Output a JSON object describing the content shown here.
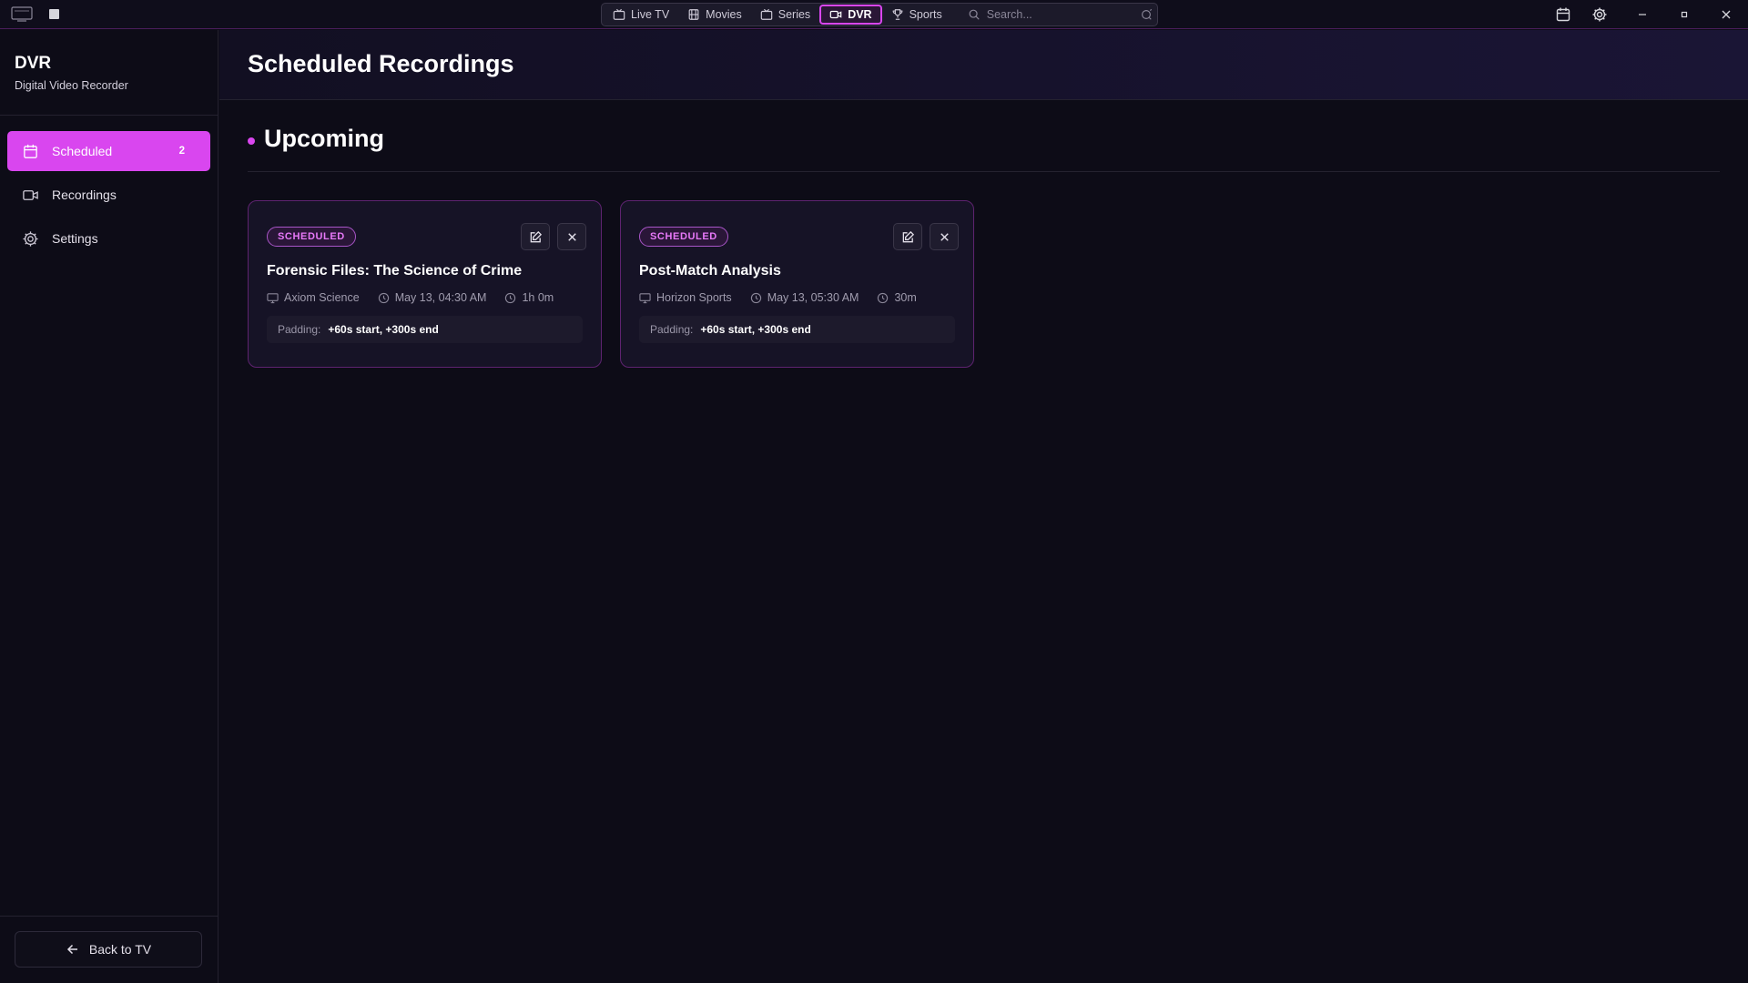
{
  "titlebar": {
    "nav_tabs": [
      {
        "label": "Live TV",
        "icon": "tv-icon"
      },
      {
        "label": "Movies",
        "icon": "film-icon"
      },
      {
        "label": "Series",
        "icon": "tv-icon"
      },
      {
        "label": "DVR",
        "icon": "video-icon",
        "active": true
      },
      {
        "label": "Sports",
        "icon": "trophy-icon"
      }
    ],
    "search_placeholder": "Search...",
    "accent": "#d946ef"
  },
  "sidebar": {
    "title": "DVR",
    "subtitle": "Digital Video Recorder",
    "items": [
      {
        "label": "Scheduled",
        "badge": "2",
        "icon": "calendar-icon",
        "active": true
      },
      {
        "label": "Recordings",
        "icon": "video-icon"
      },
      {
        "label": "Settings",
        "icon": "gear-icon"
      }
    ],
    "back_label": "Back to TV"
  },
  "main": {
    "title": "Scheduled Recordings",
    "section_title": "Upcoming",
    "cards": [
      {
        "status": "SCHEDULED",
        "title": "Forensic Files: The Science of Crime",
        "channel": "Axiom Science",
        "datetime": "May 13, 04:30 AM",
        "duration": "1h 0m",
        "padding_label": "Padding:",
        "padding_value": "+60s start, +300s end"
      },
      {
        "status": "SCHEDULED",
        "title": "Post-Match Analysis",
        "channel": "Horizon Sports",
        "datetime": "May 13, 05:30 AM",
        "duration": "30m",
        "padding_label": "Padding:",
        "padding_value": "+60s start, +300s end"
      }
    ]
  }
}
